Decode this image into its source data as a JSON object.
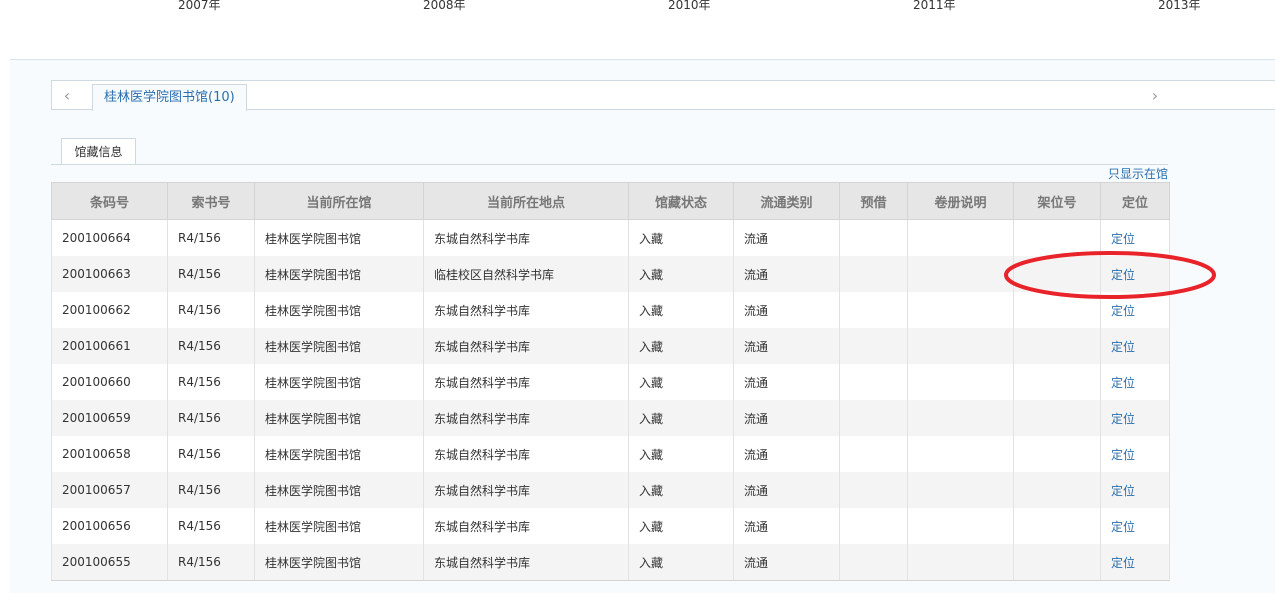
{
  "timeline": {
    "years": [
      "2007年",
      "2008年",
      "2010年",
      "2011年",
      "2013年"
    ]
  },
  "tabs": {
    "prev_arrow": "‹",
    "next_arrow": "›",
    "active": "桂林医学院图书馆(10)"
  },
  "subtab": {
    "label": "馆藏信息"
  },
  "filter_link": "只显示在馆",
  "table": {
    "headers": [
      "条码号",
      "索书号",
      "当前所在馆",
      "当前所在地点",
      "馆藏状态",
      "流通类别",
      "预借",
      "卷册说明",
      "架位号",
      "定位"
    ],
    "rows": [
      {
        "barcode": "200100664",
        "call_no": "R4/156",
        "library": "桂林医学院图书馆",
        "location": "东城自然科学书库",
        "status": "入藏",
        "circulation": "流通",
        "reserve": "",
        "volume": "",
        "shelf": "",
        "locate": "定位"
      },
      {
        "barcode": "200100663",
        "call_no": "R4/156",
        "library": "桂林医学院图书馆",
        "location": "临桂校区自然科学书库",
        "status": "入藏",
        "circulation": "流通",
        "reserve": "",
        "volume": "",
        "shelf": "",
        "locate": "定位"
      },
      {
        "barcode": "200100662",
        "call_no": "R4/156",
        "library": "桂林医学院图书馆",
        "location": "东城自然科学书库",
        "status": "入藏",
        "circulation": "流通",
        "reserve": "",
        "volume": "",
        "shelf": "",
        "locate": "定位"
      },
      {
        "barcode": "200100661",
        "call_no": "R4/156",
        "library": "桂林医学院图书馆",
        "location": "东城自然科学书库",
        "status": "入藏",
        "circulation": "流通",
        "reserve": "",
        "volume": "",
        "shelf": "",
        "locate": "定位"
      },
      {
        "barcode": "200100660",
        "call_no": "R4/156",
        "library": "桂林医学院图书馆",
        "location": "东城自然科学书库",
        "status": "入藏",
        "circulation": "流通",
        "reserve": "",
        "volume": "",
        "shelf": "",
        "locate": "定位"
      },
      {
        "barcode": "200100659",
        "call_no": "R4/156",
        "library": "桂林医学院图书馆",
        "location": "东城自然科学书库",
        "status": "入藏",
        "circulation": "流通",
        "reserve": "",
        "volume": "",
        "shelf": "",
        "locate": "定位"
      },
      {
        "barcode": "200100658",
        "call_no": "R4/156",
        "library": "桂林医学院图书馆",
        "location": "东城自然科学书库",
        "status": "入藏",
        "circulation": "流通",
        "reserve": "",
        "volume": "",
        "shelf": "",
        "locate": "定位"
      },
      {
        "barcode": "200100657",
        "call_no": "R4/156",
        "library": "桂林医学院图书馆",
        "location": "东城自然科学书库",
        "status": "入藏",
        "circulation": "流通",
        "reserve": "",
        "volume": "",
        "shelf": "",
        "locate": "定位"
      },
      {
        "barcode": "200100656",
        "call_no": "R4/156",
        "library": "桂林医学院图书馆",
        "location": "东城自然科学书库",
        "status": "入藏",
        "circulation": "流通",
        "reserve": "",
        "volume": "",
        "shelf": "",
        "locate": "定位"
      },
      {
        "barcode": "200100655",
        "call_no": "R4/156",
        "library": "桂林医学院图书馆",
        "location": "东城自然科学书库",
        "status": "入藏",
        "circulation": "流通",
        "reserve": "",
        "volume": "",
        "shelf": "",
        "locate": "定位"
      }
    ]
  },
  "colors": {
    "link": "#2a6fb0",
    "annotation": "#e8232a",
    "header_bg": "#e6e6e6",
    "stripe_bg": "#f4f4f4",
    "panel_bg": "#f7fbfd"
  }
}
